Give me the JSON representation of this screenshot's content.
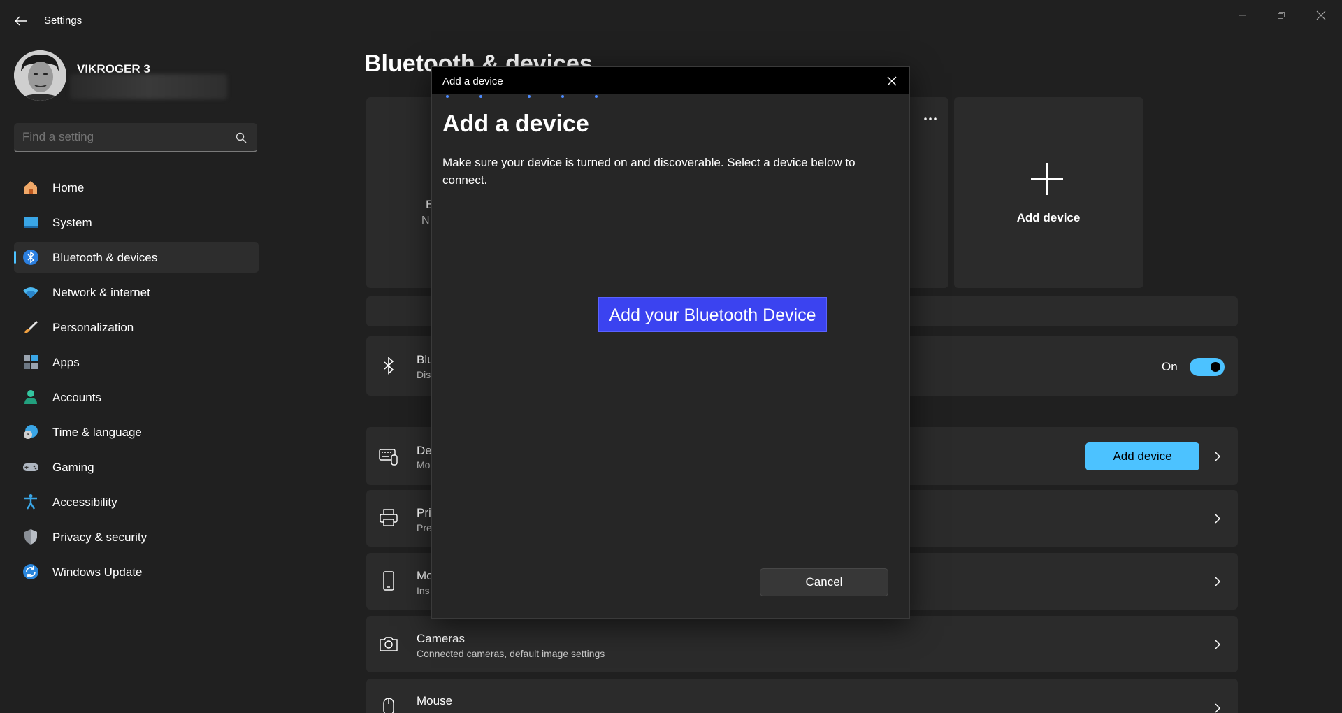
{
  "window": {
    "title": "Settings"
  },
  "profile": {
    "name": "VIKROGER 3"
  },
  "search": {
    "placeholder": "Find a setting"
  },
  "sidebar": {
    "items": [
      {
        "label": "Home",
        "icon": "home-icon"
      },
      {
        "label": "System",
        "icon": "system-icon"
      },
      {
        "label": "Bluetooth & devices",
        "icon": "bluetooth-icon",
        "active": true
      },
      {
        "label": "Network & internet",
        "icon": "wifi-icon"
      },
      {
        "label": "Personalization",
        "icon": "brush-icon"
      },
      {
        "label": "Apps",
        "icon": "apps-icon"
      },
      {
        "label": "Accounts",
        "icon": "accounts-icon"
      },
      {
        "label": "Time & language",
        "icon": "clock-globe-icon"
      },
      {
        "label": "Gaming",
        "icon": "gamepad-icon"
      },
      {
        "label": "Accessibility",
        "icon": "accessibility-icon"
      },
      {
        "label": "Privacy & security",
        "icon": "shield-icon"
      },
      {
        "label": "Windows Update",
        "icon": "update-icon"
      }
    ]
  },
  "main": {
    "page_title": "Bluetooth & devices",
    "tile_fragment_title": "B",
    "tile_fragment_sub": "N",
    "add_device_tile_label": "Add device",
    "bluetooth_row": {
      "title_fragment": "Blu",
      "sub_fragment": "Dis",
      "toggle_label": "On"
    },
    "devices_row": {
      "title_fragment": "De",
      "sub_fragment": "Mo",
      "button_label": "Add device"
    },
    "printers_row": {
      "title_fragment": "Pri",
      "sub_fragment": "Pre"
    },
    "mobile_row": {
      "title_fragment": "Mo",
      "sub_fragment": "Ins"
    },
    "cameras_row": {
      "title": "Cameras",
      "sub": "Connected cameras, default image settings"
    },
    "mouse_row": {
      "title": "Mouse"
    }
  },
  "dialog": {
    "titlebar": "Add a device",
    "heading": "Add a device",
    "description": "Make sure your device is turned on and discoverable. Select a device below to connect.",
    "bluetooth_button": "Add your Bluetooth Device",
    "cancel": "Cancel"
  },
  "colors": {
    "accent": "#4cc2ff",
    "dialog_button": "#3b43f0",
    "background": "#202020",
    "card": "#2b2b2b"
  }
}
